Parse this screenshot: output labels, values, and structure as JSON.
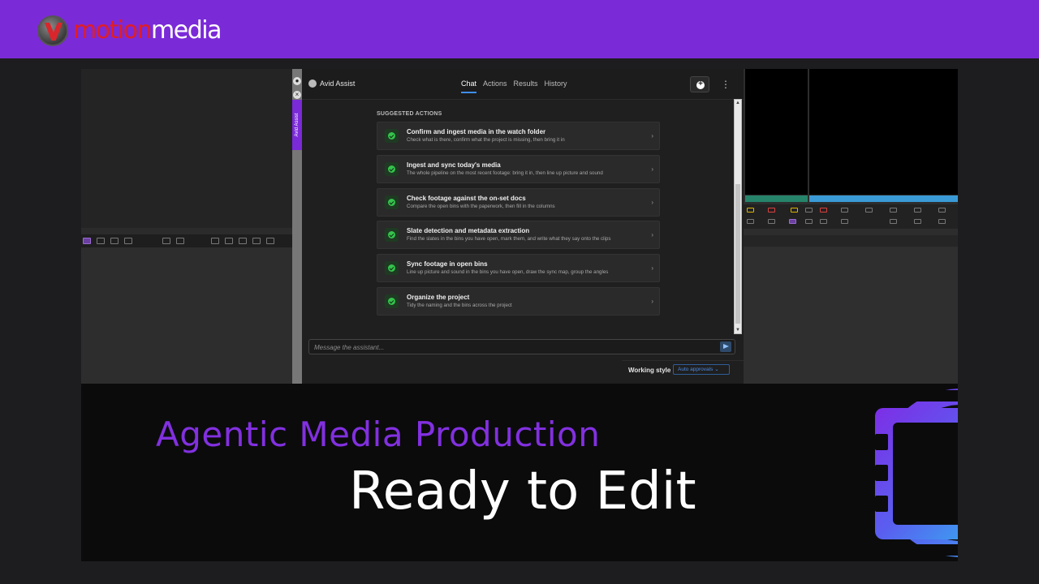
{
  "brand": {
    "part1": "motion",
    "part2": "media"
  },
  "assistant": {
    "title": "Avid Assist",
    "tabs": [
      {
        "label": "Chat",
        "active": true
      },
      {
        "label": "Actions",
        "active": false
      },
      {
        "label": "Results",
        "active": false
      },
      {
        "label": "History",
        "active": false
      }
    ],
    "side_tab": "Avid Assist",
    "section_title": "SUGGESTED ACTIONS",
    "actions": [
      {
        "title": "Confirm and ingest media in the watch folder",
        "desc": "Check what is there, confirm what the project is missing, then bring it in"
      },
      {
        "title": "Ingest and sync today's media",
        "desc": "The whole pipeline on the most recent footage: bring it in, then line up picture and sound"
      },
      {
        "title": "Check footage against the on-set docs",
        "desc": "Compare the open bins with the paperwork, then fill in the columns"
      },
      {
        "title": "Slate detection and metadata extraction",
        "desc": "Find the slates in the bins you have open, mark them, and write what they say onto the clips"
      },
      {
        "title": "Sync footage in open bins",
        "desc": "Line up picture and sound in the bins you have open, draw the sync map, group the angles"
      },
      {
        "title": "Organize the project",
        "desc": "Tidy the naming and the bins across the project"
      }
    ],
    "message_placeholder": "Message the assistant...",
    "working_style_label": "Working style",
    "working_style_value": "Auto approvals",
    "kebab": "⋮"
  },
  "headline": {
    "line1": "Agentic Media Production",
    "line2": "Ready to Edit"
  },
  "colors": {
    "banner": "#7b2ad8",
    "accent_purple": "#8230e0",
    "check_green": "#35c24c",
    "tab_underline": "#3f8ef2"
  }
}
